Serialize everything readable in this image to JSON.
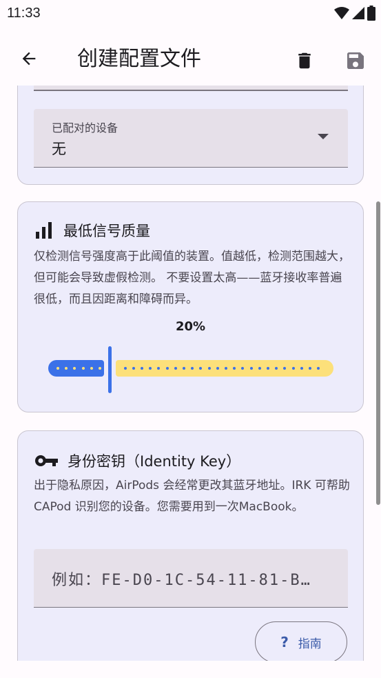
{
  "status_bar": {
    "time": "11:33"
  },
  "app_bar": {
    "title": "创建配置文件"
  },
  "paired_device": {
    "label": "已配对的设备",
    "value": "无"
  },
  "signal": {
    "title": "最低信号质量",
    "description": "仅检测信号强度高于此阈值的装置。值越低，检测范围越大，但可能会导致虚假检测。 不要设置太高——蓝牙接收率普遍很低，而且因距离和障碍而异。",
    "value_label": "20%",
    "value_fraction": 0.2
  },
  "identity": {
    "title": "身份密钥（Identity Key）",
    "description": "出于隐私原因，AirPods 会经常更改其蓝牙地址。IRK 可帮助 CAPod 识别您的设备。您需要用到一次MacBook。",
    "placeholder": "例如：FE-D0-1C-54-11-81-B…",
    "guide_label": "指南",
    "guide_icon": "?"
  },
  "colors": {
    "accent": "#3b71e8",
    "track_inactive": "#fce07a",
    "card_bg": "#edecfb"
  }
}
